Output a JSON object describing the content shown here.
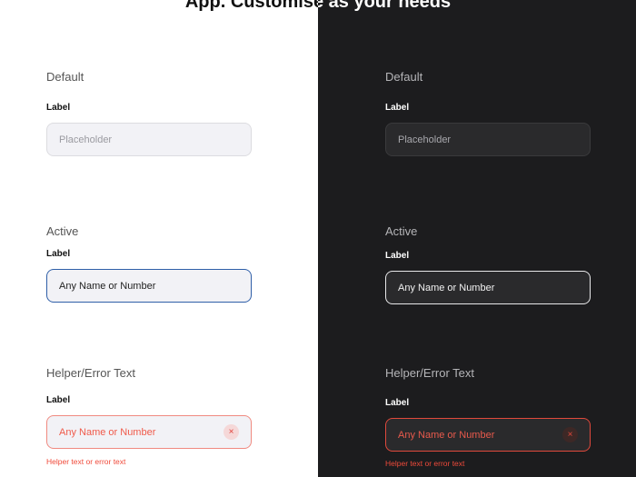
{
  "title": "App. Customise as your needs",
  "panels": {
    "light": {
      "default_heading": "Default",
      "active_heading": "Active",
      "error_heading": "Helper/Error Text",
      "label": "Label",
      "placeholder": "Placeholder",
      "active_value": "Any Name or Number",
      "error_value": "Any Name or Number",
      "helper": "Helper text or error text",
      "clear_icon": "×"
    },
    "dark": {
      "default_heading": "Default",
      "active_heading": "Active",
      "error_heading": "Helper/Error Text",
      "label": "Label",
      "placeholder": "Placeholder",
      "active_value": "Any Name or Number",
      "error_value": "Any Name or Number",
      "helper": "Helper text or error text",
      "clear_icon": "×"
    }
  },
  "colors": {
    "dark_bg": "#1c1c1e",
    "active_border": "#2f5fa8",
    "error": "#f04a3a"
  }
}
